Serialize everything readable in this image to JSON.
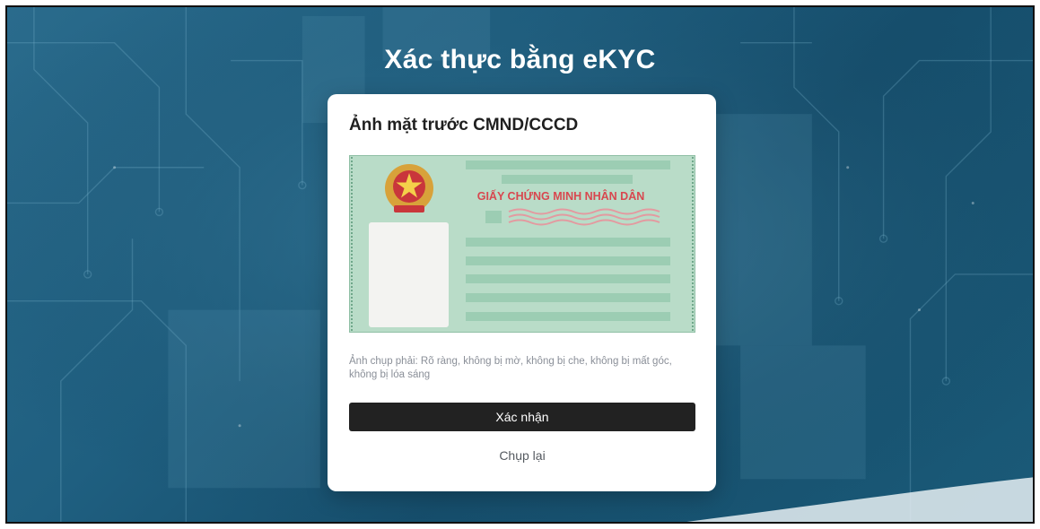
{
  "page": {
    "title": "Xác thực bằng eKYC"
  },
  "card": {
    "title": "Ảnh mặt trước CMND/CCCD",
    "id_card_illustration": {
      "header_text": "GIẤY CHỨNG MINH NHÂN DÂN",
      "emblem_icon": "vietnam-emblem-icon"
    },
    "hint": "Ảnh chụp phải: Rõ ràng, không bị mờ, không bị che, không bị mất góc, không bị lóa sáng",
    "confirm_label": "Xác nhận",
    "retake_label": "Chụp lại"
  },
  "colors": {
    "primary_button": "#222222",
    "card_green": "#b9dcc8",
    "accent_red": "#d8474f"
  }
}
